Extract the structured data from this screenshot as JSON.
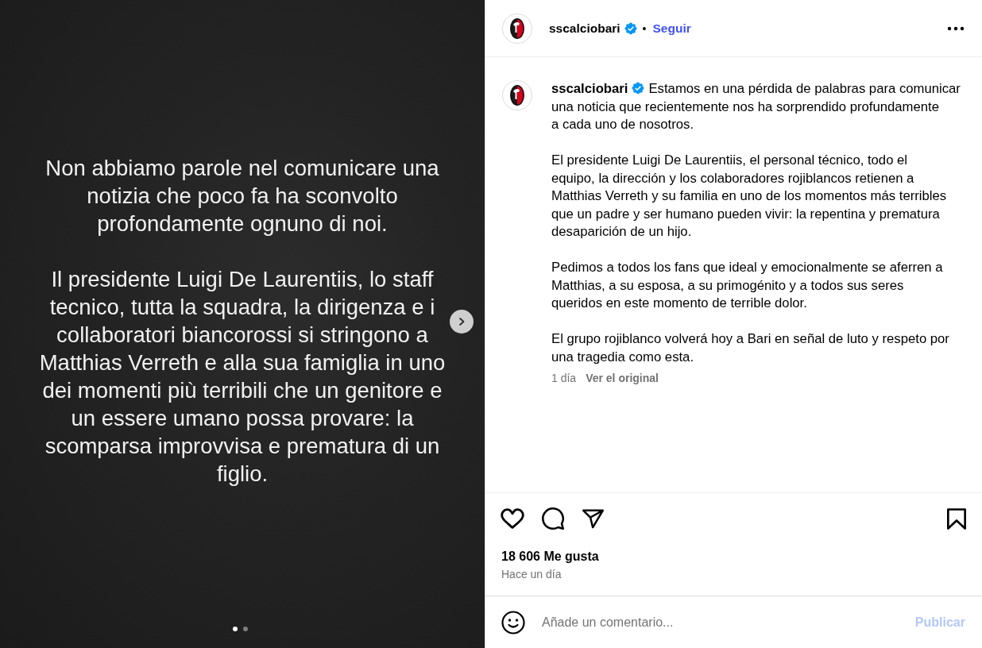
{
  "media": {
    "paragraphs": [
      "Non abbiamo parole nel comunicare una\nnotizia che poco fa ha sconvolto\nprofondamente ognuno di noi.",
      "Il presidente Luigi De Laurentiis, lo staff\ntecnico, tutta la squadra, la dirigenza e i\ncollaboratori biancorossi si stringono a\nMatthias Verreth e alla sua famiglia in uno\ndei momenti più terribili che un genitore e\nun essere umano possa provare: la\nscomparsa improvvisa e prematura di un\nfiglio."
    ],
    "slide_dots": [
      {
        "selected": true
      },
      {
        "selected": false
      }
    ]
  },
  "header": {
    "username": "sscalciobari",
    "verified": true,
    "separator": "•",
    "follow": "Seguir"
  },
  "caption": {
    "username": "sscalciobari",
    "verified": true,
    "paragraphs": [
      "Estamos en una pérdida de palabras para comunicar\nuna noticia que recientemente nos ha sorprendido profundamente\na cada uno de nosotros.",
      "El presidente Luigi De Laurentiis, el personal técnico, todo el\nequipo, la dirección y los colaboradores rojiblancos retienen a\nMatthias Verreth y su familia en uno de los momentos más terribles\nque un padre y ser humano pueden vivir: la repentina y prematura\ndesaparición de un hijo.",
      "Pedimos a todos los fans que ideal y emocionalmente se aferren a\nMatthias, a su esposa, a su primogénito y a todos sus seres\nqueridos en este momento de terrible dolor.",
      "El grupo rojiblanco volverá hoy a Bari en señal de luto y respeto por\nuna tragedia como esta."
    ],
    "time": "1 día",
    "translation_link": "Ver el original"
  },
  "actions": {
    "liked": false,
    "saved": false
  },
  "likes": "18 606 Me gusta",
  "date": "Hace un día",
  "comment": {
    "placeholder": "Añade un comentario...",
    "submit": "Publicar",
    "submit_disabled": true
  }
}
